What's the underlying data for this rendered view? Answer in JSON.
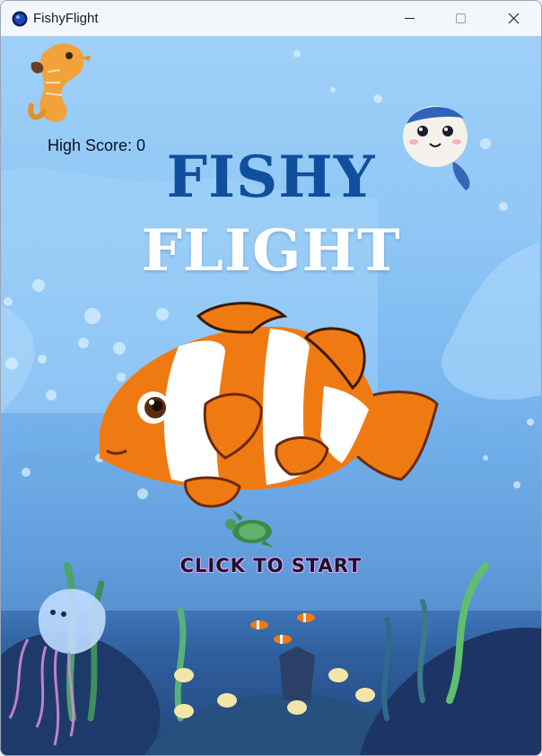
{
  "window": {
    "title": "FishyFlight",
    "controls": [
      "minimize",
      "maximize",
      "close"
    ]
  },
  "game": {
    "high_score_label": "High Score: 0",
    "title_line_1": "FISHY",
    "title_line_2": "FLIGHT",
    "start_prompt": "CLICK TO START"
  },
  "colors": {
    "title_blue": "#0f4f9c",
    "title_white": "#ffffff",
    "clownfish_orange": "#f07a12"
  },
  "icons": [
    "app-icon",
    "minimize-icon",
    "maximize-icon",
    "close-icon"
  ]
}
